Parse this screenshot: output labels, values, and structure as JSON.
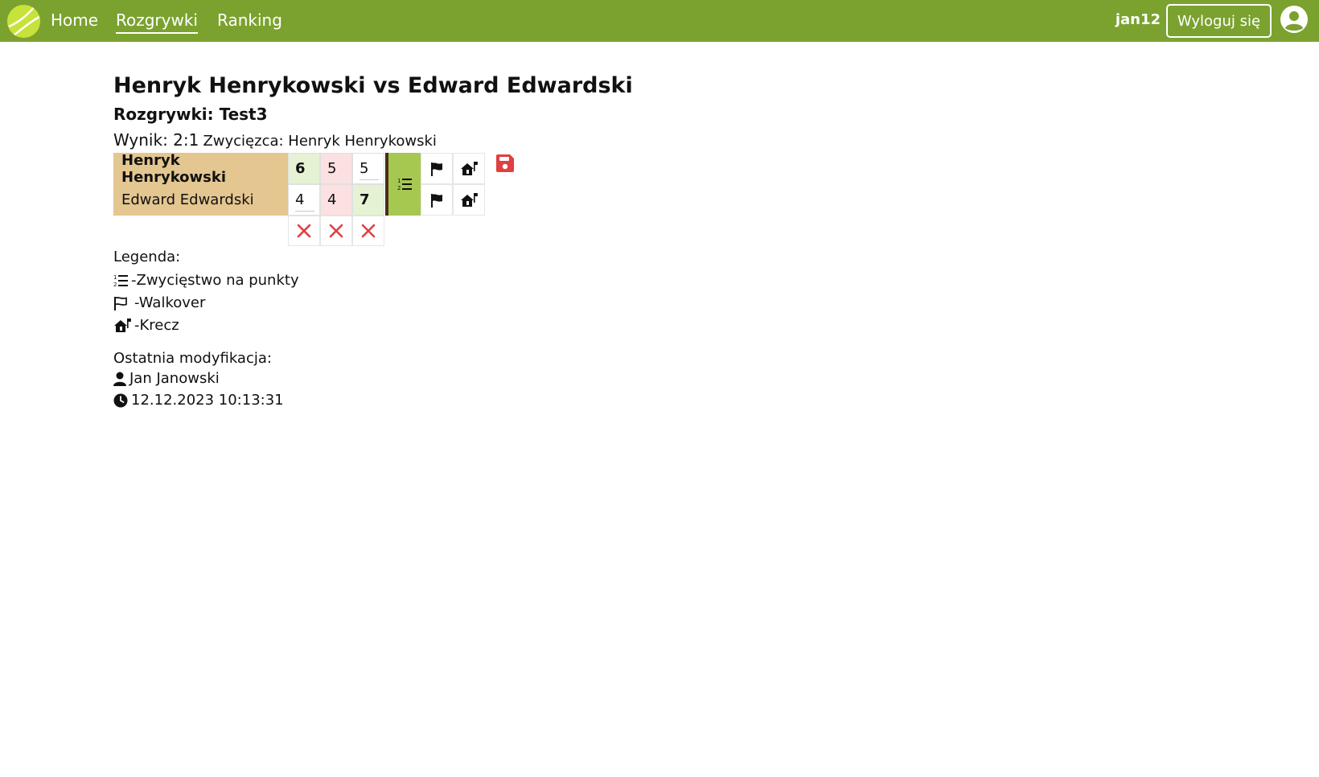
{
  "nav": {
    "links": [
      "Home",
      "Rozgrywki",
      "Ranking"
    ],
    "active_index": 1,
    "username": "jan12",
    "logout_label": "Wyloguj się"
  },
  "match": {
    "title": "Henryk Henrykowski vs Edward Edwardski",
    "competition": "Rozgrywki: Test3",
    "result": "Wynik: 2:1",
    "winner": "Zwycięzca: Henryk Henrykowski",
    "players": [
      {
        "name": "Henryk Henrykowski",
        "scores": [
          "6",
          "5",
          "5"
        ],
        "winner": true
      },
      {
        "name": "Edward Edwardski",
        "scores": [
          "4",
          "4",
          "7"
        ],
        "winner": false
      }
    ]
  },
  "legend": {
    "title": "Legenda:",
    "points": "-Zwycięstwo na punkty",
    "walkover": "-Walkover",
    "krecz": "-Krecz"
  },
  "modified": {
    "title": "Ostatnia modyfikacja:",
    "user": "Jan Janowski",
    "timestamp": "12.12.2023 10:13:31"
  },
  "colors": {
    "navbar": "#7ba22f",
    "player_cell": "#e4c690",
    "win_cell": "#e6f2d4",
    "lose_cell": "#fbe1e1",
    "points_button": "#a6c850",
    "delete": "#e04040",
    "save": "#e04040"
  },
  "icons": {
    "logo": "tennis-ball-icon",
    "avatar": "user-circle-icon",
    "points": "list-ol-icon",
    "walkover": "flag-icon",
    "krecz": "house-flag-icon",
    "delete": "x-icon",
    "save": "floppy-disk-icon",
    "user": "user-icon",
    "clock": "clock-icon"
  }
}
